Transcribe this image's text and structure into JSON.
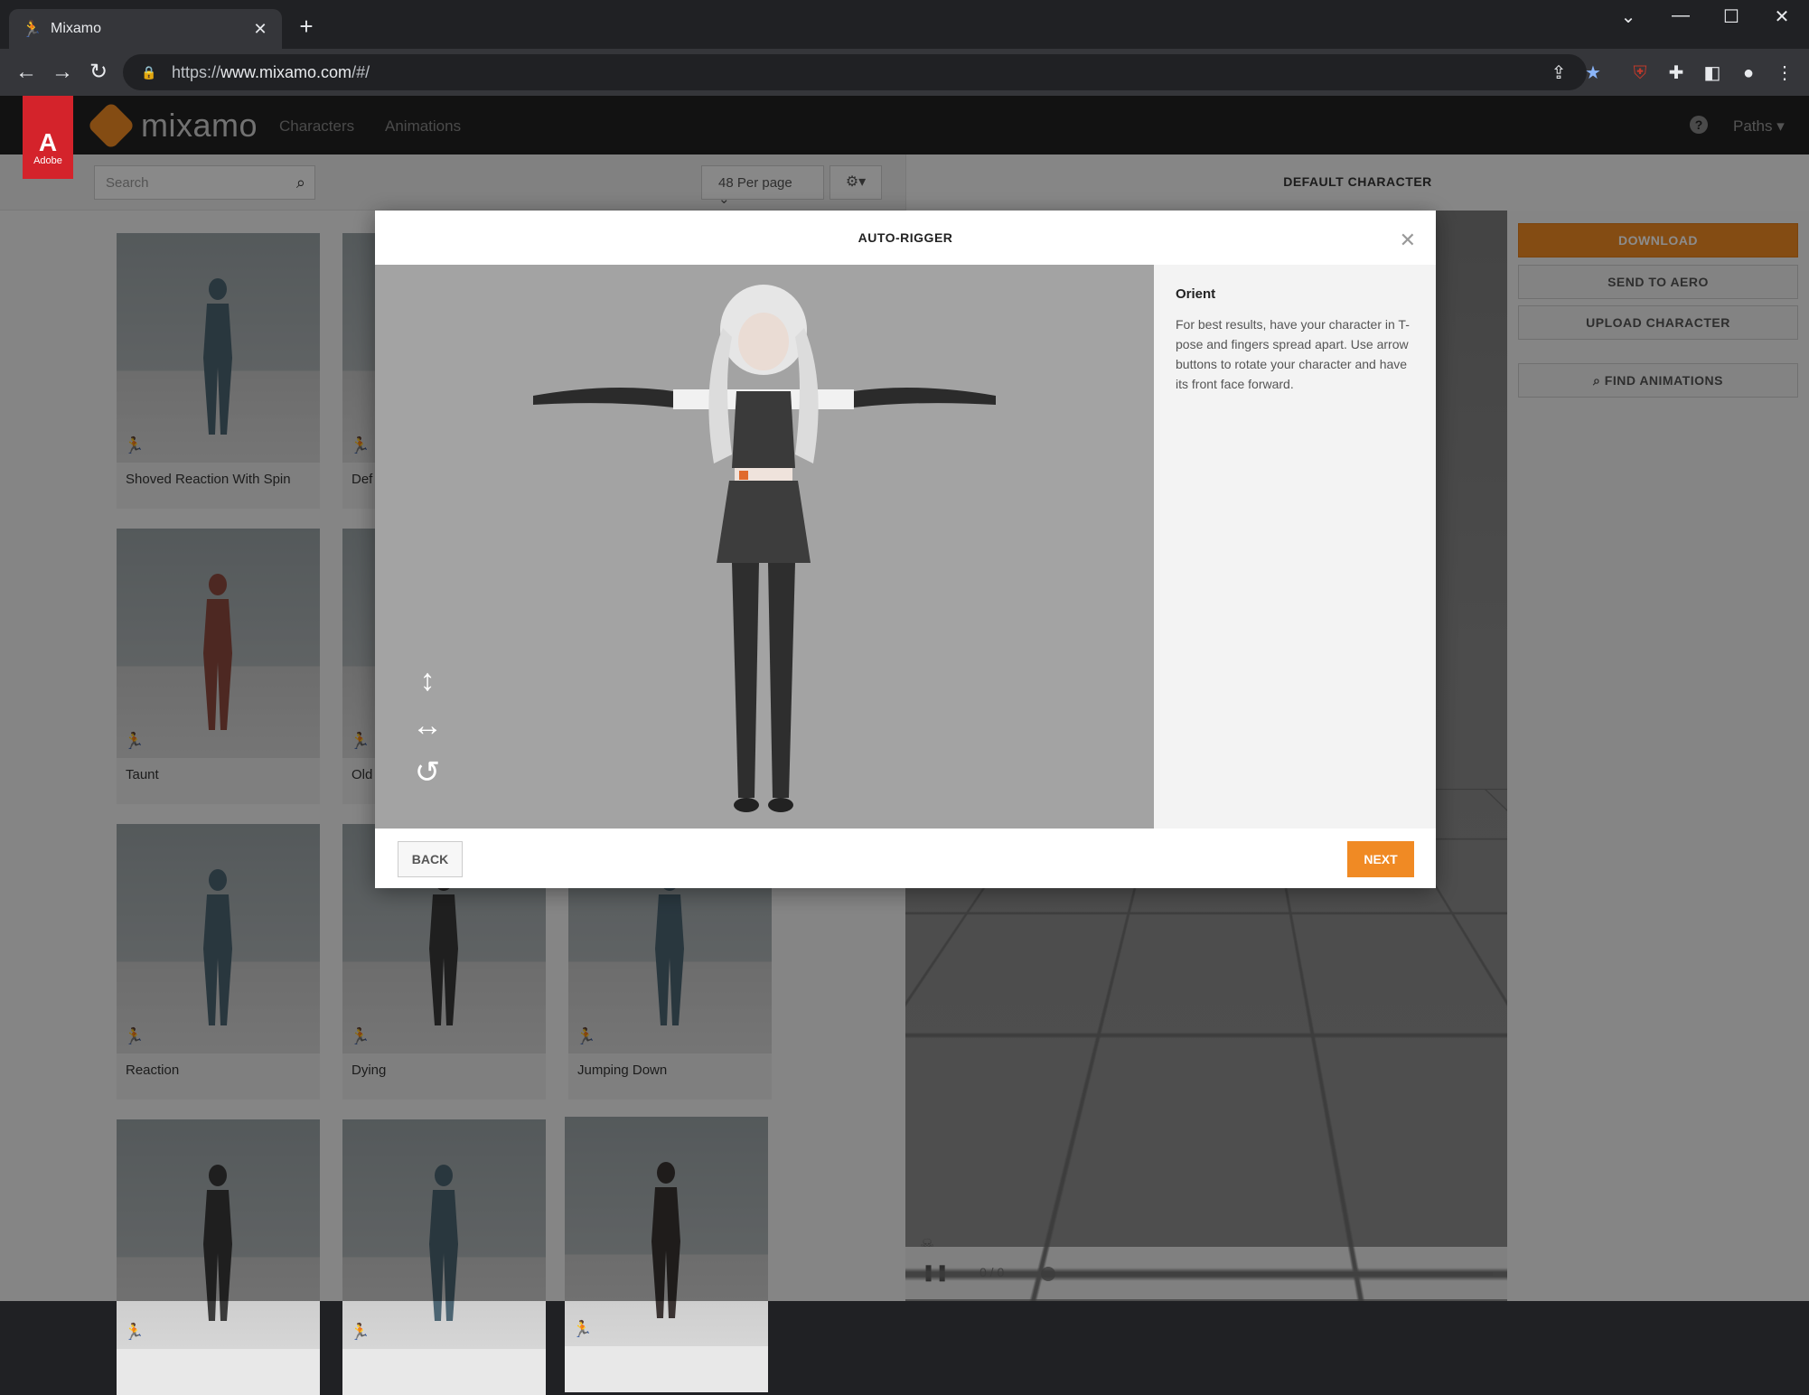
{
  "browser": {
    "tab_title": "Mixamo",
    "url_scheme": "https://",
    "url_host": "www.mixamo.com",
    "url_path": "/#/"
  },
  "header": {
    "adobe_label": "Adobe",
    "logo_text": "mixamo",
    "nav": [
      "Characters",
      "Animations"
    ],
    "paths_label": "Paths",
    "help_label": "?"
  },
  "toolbar": {
    "search_placeholder": "Search",
    "per_page": "48 Per page"
  },
  "right_header": "DEFAULT CHARACTER",
  "cards": [
    {
      "label": "Shoved Reaction With Spin",
      "figure_color": "#4b6472"
    },
    {
      "label": "Def",
      "figure_color": "#4b6472"
    },
    {
      "label": "Taunt",
      "figure_color": "#8c4a3f"
    },
    {
      "label": "Old",
      "figure_color": "#4b6472"
    },
    {
      "label": "Reaction",
      "figure_color": "#4b6472"
    },
    {
      "label": "Dying",
      "figure_color": "#3a3a3a"
    },
    {
      "label": "Jumping Down",
      "figure_color": "#4b6472"
    },
    {
      "label": "",
      "figure_color": "#3a3a3a"
    },
    {
      "label": "",
      "figure_color": "#4b6472"
    },
    {
      "label": "",
      "figure_color": "#3a3332"
    }
  ],
  "right_panel": {
    "download": "DOWNLOAD",
    "send_to_aero": "SEND TO AERO",
    "upload_character": "UPLOAD CHARACTER",
    "find_animations": "FIND ANIMATIONS"
  },
  "playbar": {
    "frames": "0 / 0"
  },
  "modal": {
    "title": "AUTO-RIGGER",
    "info_heading": "Orient",
    "info_text": "For best results, have your character in T-pose and fingers spread apart. Use arrow buttons to rotate your character and have its front face forward.",
    "back": "BACK",
    "next": "NEXT"
  },
  "colors": {
    "accent": "#f08a24",
    "adobe_red": "#d4232b"
  }
}
